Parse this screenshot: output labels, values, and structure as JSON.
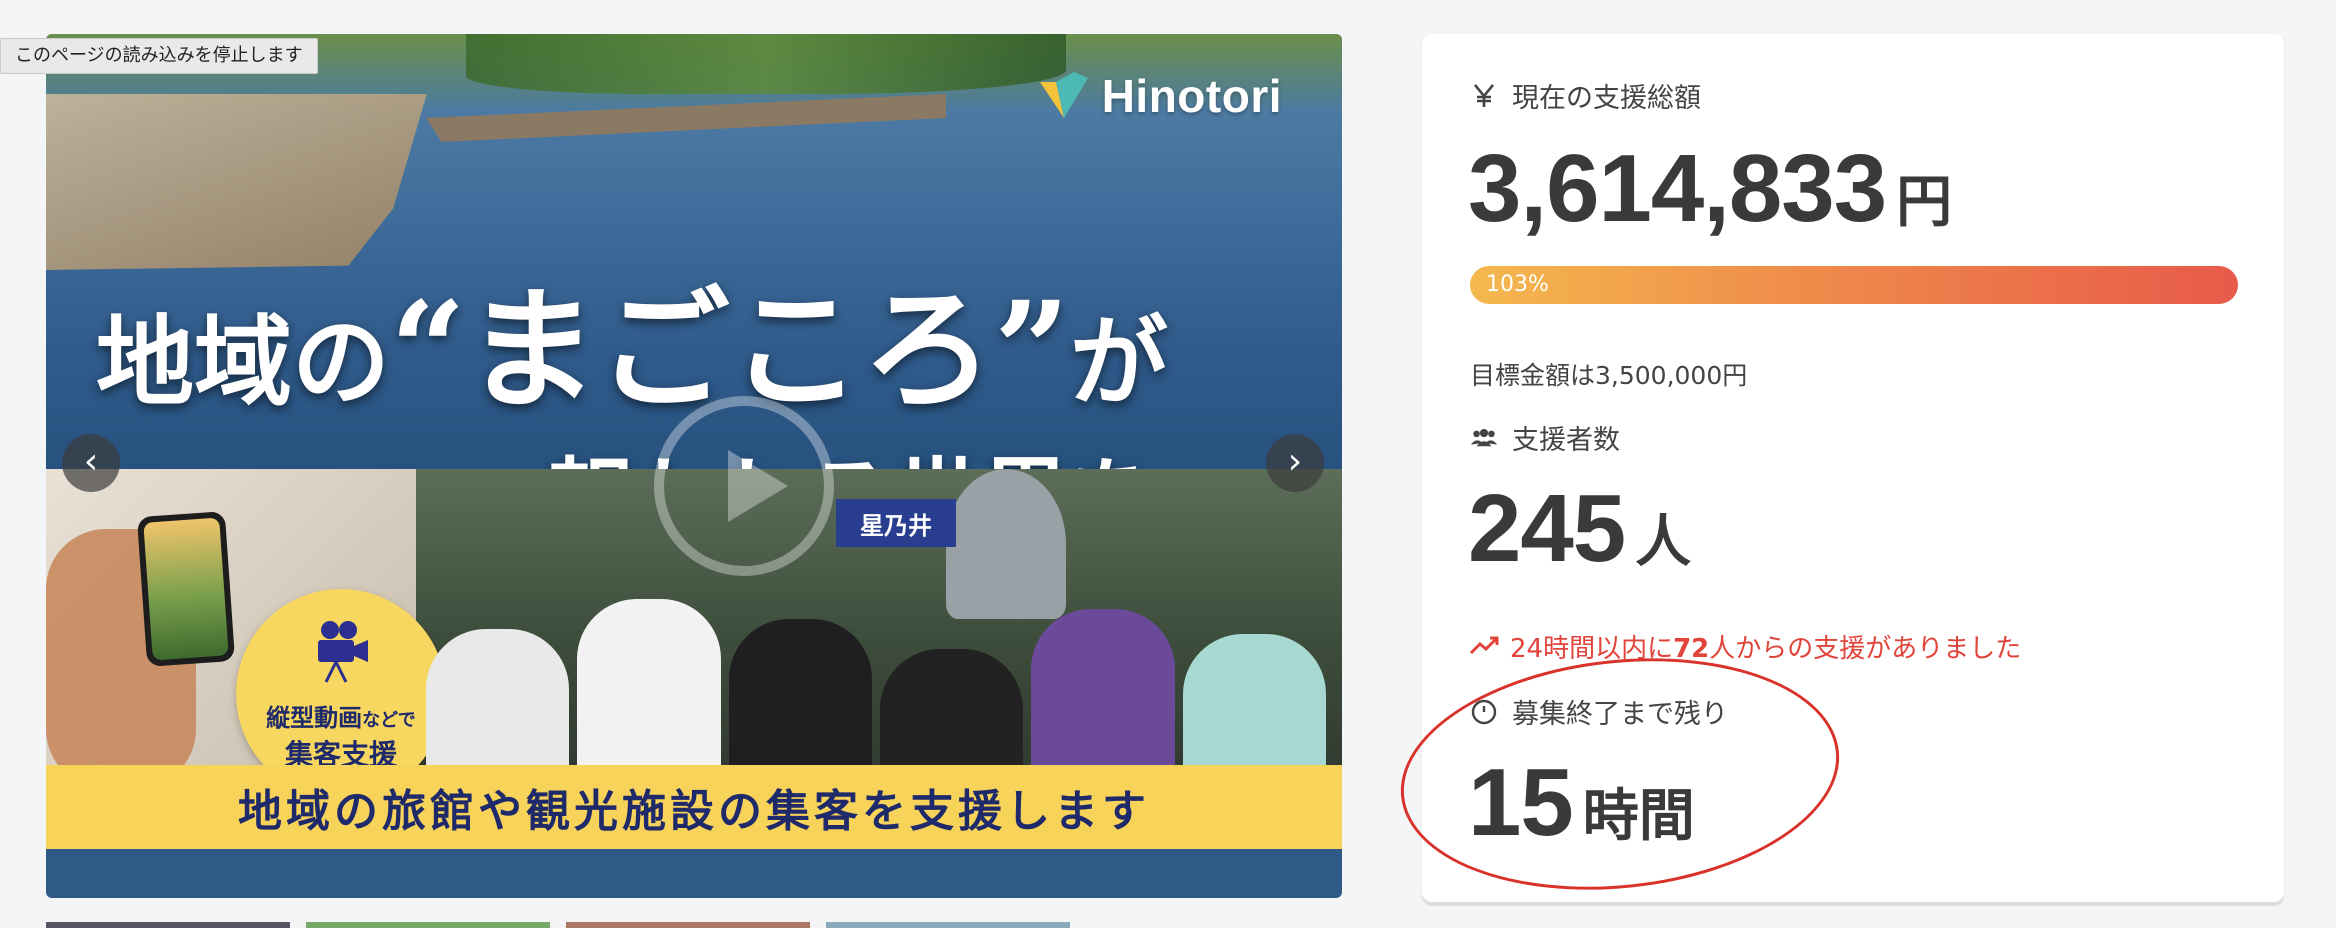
{
  "browser": {
    "stop_loading_tooltip": "このページの読み込みを停止します"
  },
  "hero": {
    "logo_text": "Hinotori",
    "headline_part1": "地域の",
    "headline_quote_open": "“",
    "headline_emphasis": "まごころ",
    "headline_quote_close": "”",
    "headline_part2": "が",
    "headline_line2": "報われる世界を。",
    "badge_line1_main": "縦型動画",
    "badge_line1_small": "などで",
    "badge_line2": "集客支援",
    "sign_text": "星乃井",
    "banner_text": "地域の旅館や観光施設の集客を支援します",
    "prev_icon": "chevron-left-icon",
    "next_icon": "chevron-right-icon"
  },
  "stats": {
    "total_label": "現在の支援総額",
    "total_icon": "yen-icon",
    "total_value": "3,614,833",
    "total_unit": "円",
    "progress_percent": 103,
    "progress_label": "103%",
    "goal_text": "目標金額は3,500,000円",
    "backers_label": "支援者数",
    "backers_icon": "users-icon",
    "backers_value": "245",
    "backers_unit": "人",
    "recent_icon": "trending-up-icon",
    "recent_prefix": "24時間以内に",
    "recent_count": "72",
    "recent_suffix": "人からの支援がありました",
    "remaining_label": "募集終了まで残り",
    "remaining_icon": "clock-icon",
    "remaining_value": "15",
    "remaining_unit": "時間"
  },
  "colors": {
    "accent_red": "#e0443a",
    "progress_start": "#f4b84d",
    "progress_end": "#e85a4a",
    "banner_yellow": "#f7d35a"
  }
}
